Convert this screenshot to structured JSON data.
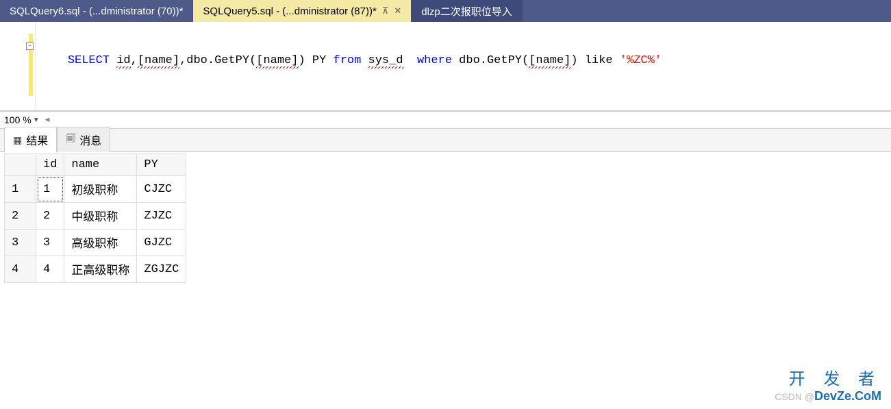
{
  "tabs": {
    "inactive1": "SQLQuery6.sql - (...dministrator (70))*",
    "active": "SQLQuery5.sql - (...dministrator (87))*",
    "inactive2": "dlzp二次报职位导入"
  },
  "zoom": {
    "value": "100 %"
  },
  "sql": {
    "select": "SELECT",
    "ids": " id,[name],dbo.GetPY([name]) PY ",
    "from": "from",
    "table": " sys_d  ",
    "where": "where",
    "cond": " dbo.GetPY([name]) like ",
    "lit": "'%ZC%'"
  },
  "pane_tabs": {
    "results": "结果",
    "messages": "消息"
  },
  "grid": {
    "cols": [
      "id",
      "name",
      "PY"
    ],
    "rows": [
      {
        "n": "1",
        "id": "1",
        "name": "初级职称",
        "py": "CJZC"
      },
      {
        "n": "2",
        "id": "2",
        "name": "中级职称",
        "py": "ZJZC"
      },
      {
        "n": "3",
        "id": "3",
        "name": "高级职称",
        "py": "GJZC"
      },
      {
        "n": "4",
        "id": "4",
        "name": "正高级职称",
        "py": "ZGJZC"
      }
    ]
  },
  "watermark": {
    "cn": "开 发 者",
    "prefix": "CSDN @",
    "brand": "DevZe.CoM"
  }
}
